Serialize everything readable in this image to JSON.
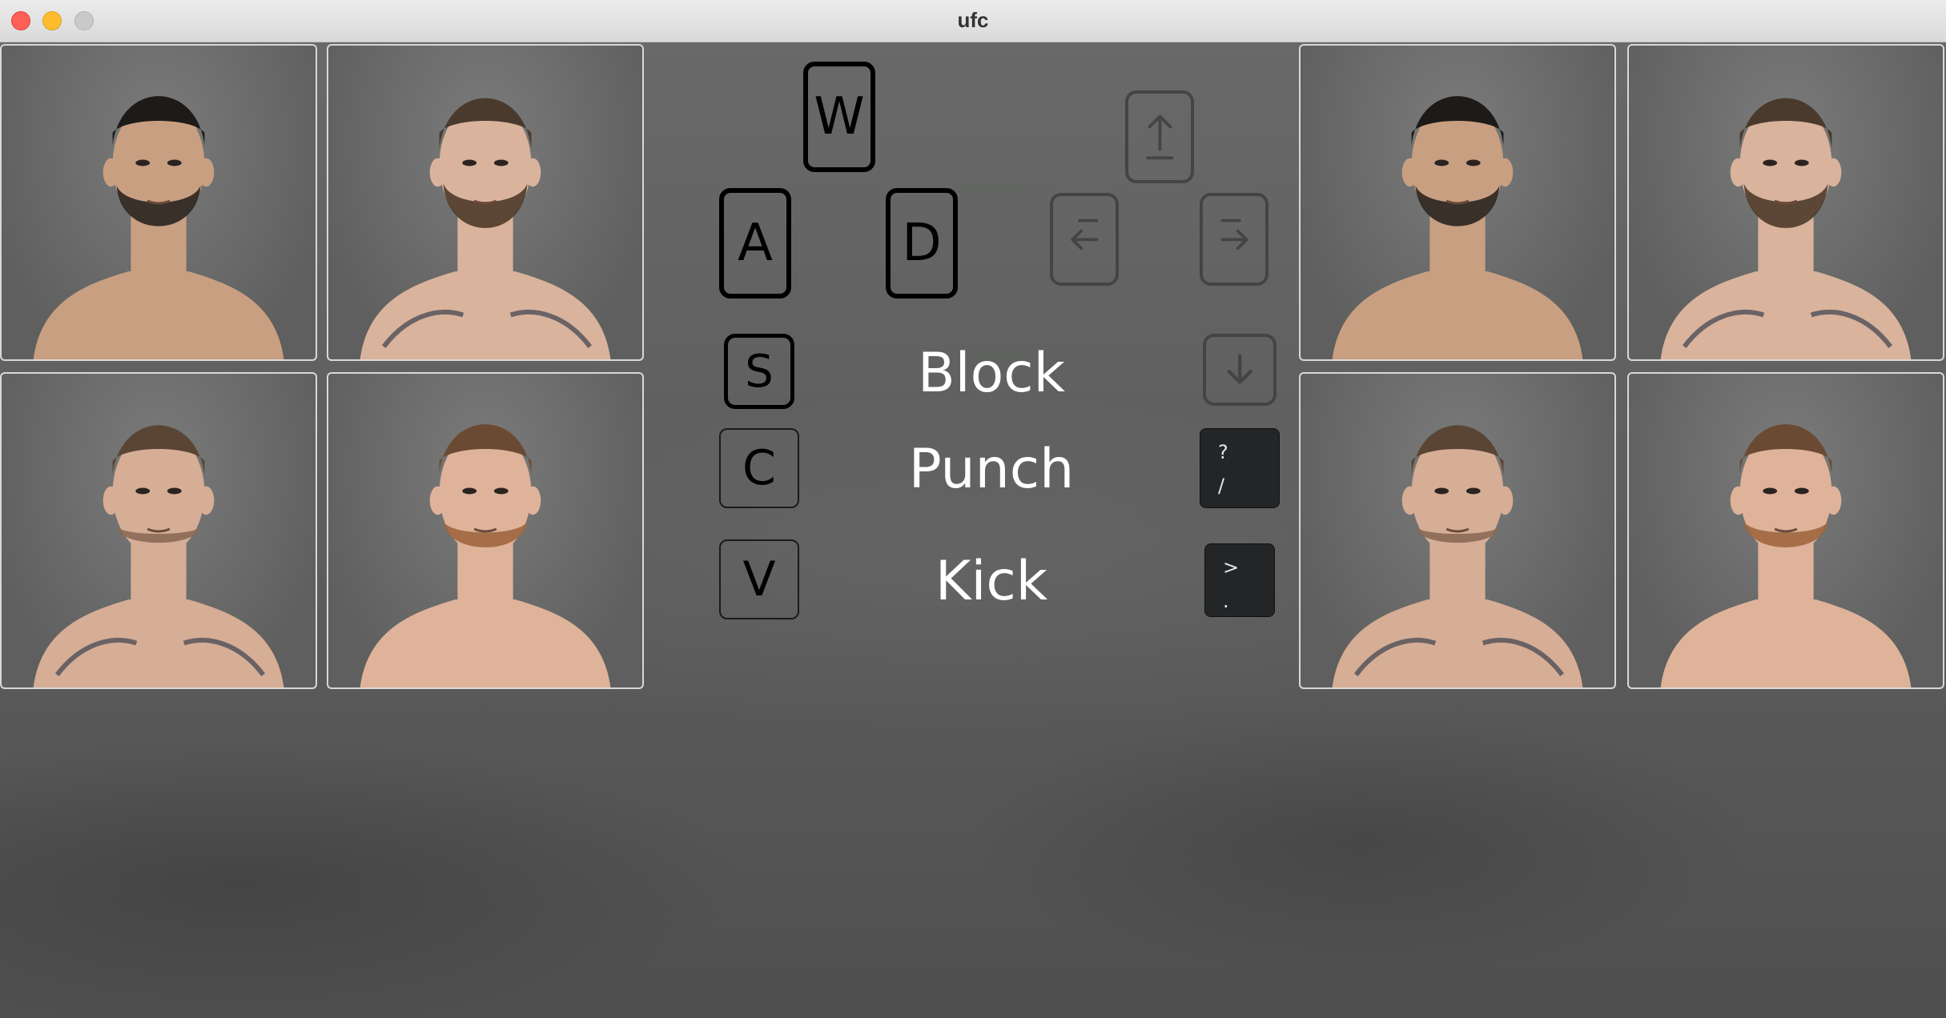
{
  "window": {
    "title": "ufc"
  },
  "fighters": {
    "left": [
      {
        "id": "khabib"
      },
      {
        "id": "mcgregor"
      },
      {
        "id": "poirier"
      },
      {
        "id": "gaethje"
      }
    ],
    "right": [
      {
        "id": "khabib"
      },
      {
        "id": "mcgregor"
      },
      {
        "id": "poirier"
      },
      {
        "id": "gaethje"
      }
    ]
  },
  "controls": {
    "player1": {
      "up": "W",
      "left": "A",
      "right": "D",
      "block": "S",
      "punch": "C",
      "kick": "V"
    },
    "player2": {
      "up": "arrow-up",
      "left": "arrow-left",
      "right": "arrow-right",
      "block": "arrow-down",
      "punch_top": "?",
      "punch_bottom": "/",
      "kick_top": ">",
      "kick_bottom": "."
    },
    "actions": {
      "block": "Block",
      "punch": "Punch",
      "kick": "Kick"
    }
  },
  "colors": {
    "background": "#5f605f",
    "card_border": "#d8d8d8",
    "label_text": "#ffffff",
    "dark_key": "#232527"
  }
}
